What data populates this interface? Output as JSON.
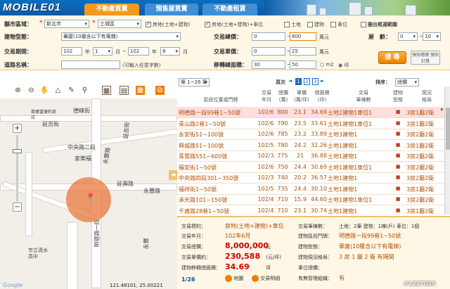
{
  "header": {
    "logo": "MOBILE01",
    "tabs": [
      {
        "label": "不動產買賣"
      },
      {
        "label": "預售屋買賣"
      },
      {
        "label": "不動產租賃"
      }
    ]
  },
  "form": {
    "county_label": "縣市區域：",
    "county_value": "新北市",
    "district_value": "土城區",
    "checks": [
      "房地(土地+建物)",
      "房地(土地+建物)+車位",
      "土地",
      "建物",
      "車位"
    ],
    "circle_label": "圈台框選範圍",
    "type_label": "建物型態：",
    "type_value": "華廈(10層含以下有電梯)",
    "total_label": "交易總價：",
    "total_from": "0",
    "total_to": "800",
    "total_unit": "萬元",
    "rooms_label": "屋　齡：",
    "rooms_from": "0",
    "rooms_to": "10",
    "rooms_sep": "~",
    "period_label": "交易期間：",
    "p_y1": "102",
    "p_m1": "1",
    "p_y2": "102",
    "p_m2": "8",
    "yr": "年",
    "mo": "月",
    "sep": "~",
    "unit_label": "交易單價：",
    "unit_from": "0",
    "unit_to": "25",
    "unit_unit": "萬元",
    "road_label": "道路名稱：",
    "road_hint": "(可輸入任意字數)",
    "area_label": "移轉總面積：",
    "area_from": "30",
    "area_to": "50",
    "area_m2": "m2",
    "area_ping": "坪",
    "search_label": "搜 尋",
    "calc_label": "預估總價 預估計算"
  },
  "map": {
    "streets": [
      "德峰街",
      "延吉街",
      "中央路二段",
      "永豐路",
      "延吉街",
      "家樂福",
      "萊爾富便利商店",
      "延壽路",
      "永豐路",
      "明德路一段",
      "市立清水高中",
      "明德路一段",
      "永豐",
      "萊爾富"
    ],
    "coords": "121.48101, 25.00221",
    "watermark": "Google",
    "zoom_plus": "+",
    "zoom_minus": "−",
    "direction": "◄"
  },
  "list": {
    "page_sel": "第 1~26 筆",
    "page_label": "頁次",
    "pages": [
      "1",
      "2",
      "3"
    ],
    "sort_label": "排序：",
    "sort_value": "總價",
    "headers": [
      "區段位置或門牌",
      "交易\n年月",
      "總價\n(萬)",
      "單價\n(萬/坪)",
      "總面積\n(坪)",
      "交易\n筆棟數",
      "建物\n型態",
      "現況\n格局"
    ],
    "rows": [
      {
        "addr": "明德路一段99巷1~50號",
        "ym": "102/6",
        "total": "800",
        "unit": "23.1",
        "area": "34.69",
        "items": "土地2建物1車位1",
        "type": "■",
        "layout": "3房1廳2衛"
      },
      {
        "addr": "青山路2巷1~50號",
        "ym": "102/6",
        "total": "790",
        "unit": "23.5",
        "area": "33.61",
        "items": "土地1建物1車位1",
        "type": "■",
        "layout": "3房1廳2衛"
      },
      {
        "addr": "永安街51~100號",
        "ym": "102/6",
        "total": "785",
        "unit": "23.2",
        "area": "33.89",
        "items": "土地3建物1",
        "type": "■",
        "layout": "3房2廳2衛"
      },
      {
        "addr": "興城路51~100號",
        "ym": "102/5",
        "total": "780",
        "unit": "24.2",
        "area": "32.26",
        "items": "土地1建物1",
        "type": "■",
        "layout": "3房1廳2衛"
      },
      {
        "addr": "青雲路551~600號",
        "ym": "102/3",
        "total": "775",
        "unit": "21",
        "area": "36.88",
        "items": "土地1建物1",
        "type": "■",
        "layout": "3房2廳2衛"
      },
      {
        "addr": "福安街1~50號",
        "ym": "102/6",
        "total": "750",
        "unit": "24.4",
        "area": "30.69",
        "items": "土地1建物1車位1",
        "type": "■",
        "layout": "3房2廳2衛"
      },
      {
        "addr": "中央路四段301~350號",
        "ym": "102/3",
        "total": "740",
        "unit": "20.2",
        "area": "36.57",
        "items": "土地1建物1",
        "type": "■",
        "layout": "3房2廳2衛"
      },
      {
        "addr": "福祥街1~50號",
        "ym": "102/5",
        "total": "735",
        "unit": "24.4",
        "area": "30.10",
        "items": "土地1建物1",
        "type": "■",
        "layout": "3房1廳2衛"
      },
      {
        "addr": "承天路101~150號",
        "ym": "102/4",
        "total": "710",
        "unit": "15.9",
        "area": "44.60",
        "items": "土地1建物1車位1",
        "type": "■",
        "layout": "3房2廳2衛"
      },
      {
        "addr": "千歲路28巷1~50號",
        "ym": "102/4",
        "total": "710",
        "unit": "23.1",
        "area": "30.74",
        "items": "土地1建物1",
        "type": "■",
        "layout": "3房1廳2衛"
      }
    ]
  },
  "detail": {
    "l1": "交易標的：",
    "v1": "房地(土地+建物)+車位",
    "l2": "交易年月：",
    "v2": "102年6月",
    "l3": "交易總價：",
    "v3": "8,000,000",
    "v3u": "元",
    "l4": "交易單價約：",
    "v4": "230,588",
    "v4u": "(元/坪)",
    "l5": "建物移轉總面積：",
    "v5": "34.69",
    "v5u": "坪",
    "pageinfo": "1/26",
    "btn1": "地圖",
    "btn2": "交易明細",
    "r1": "交易筆棟數：",
    "r1v": "土地：2筆 建物：1棟(戶) 車位：1個",
    "r2": "建物區段門牌：",
    "r2v": "明德路一段99巷1~50號",
    "r3": "建物型態：",
    "r3v": "華廈(10層含以下有電梯)",
    "r4": "建物現況格局：",
    "r4v": "3 房 1 廳 2 衛 有隔間",
    "r5": "車位總價：",
    "r5v": "",
    "r6": "有無管理組織：",
    "r6v": "有"
  },
  "watermark_id": "#1227029"
}
